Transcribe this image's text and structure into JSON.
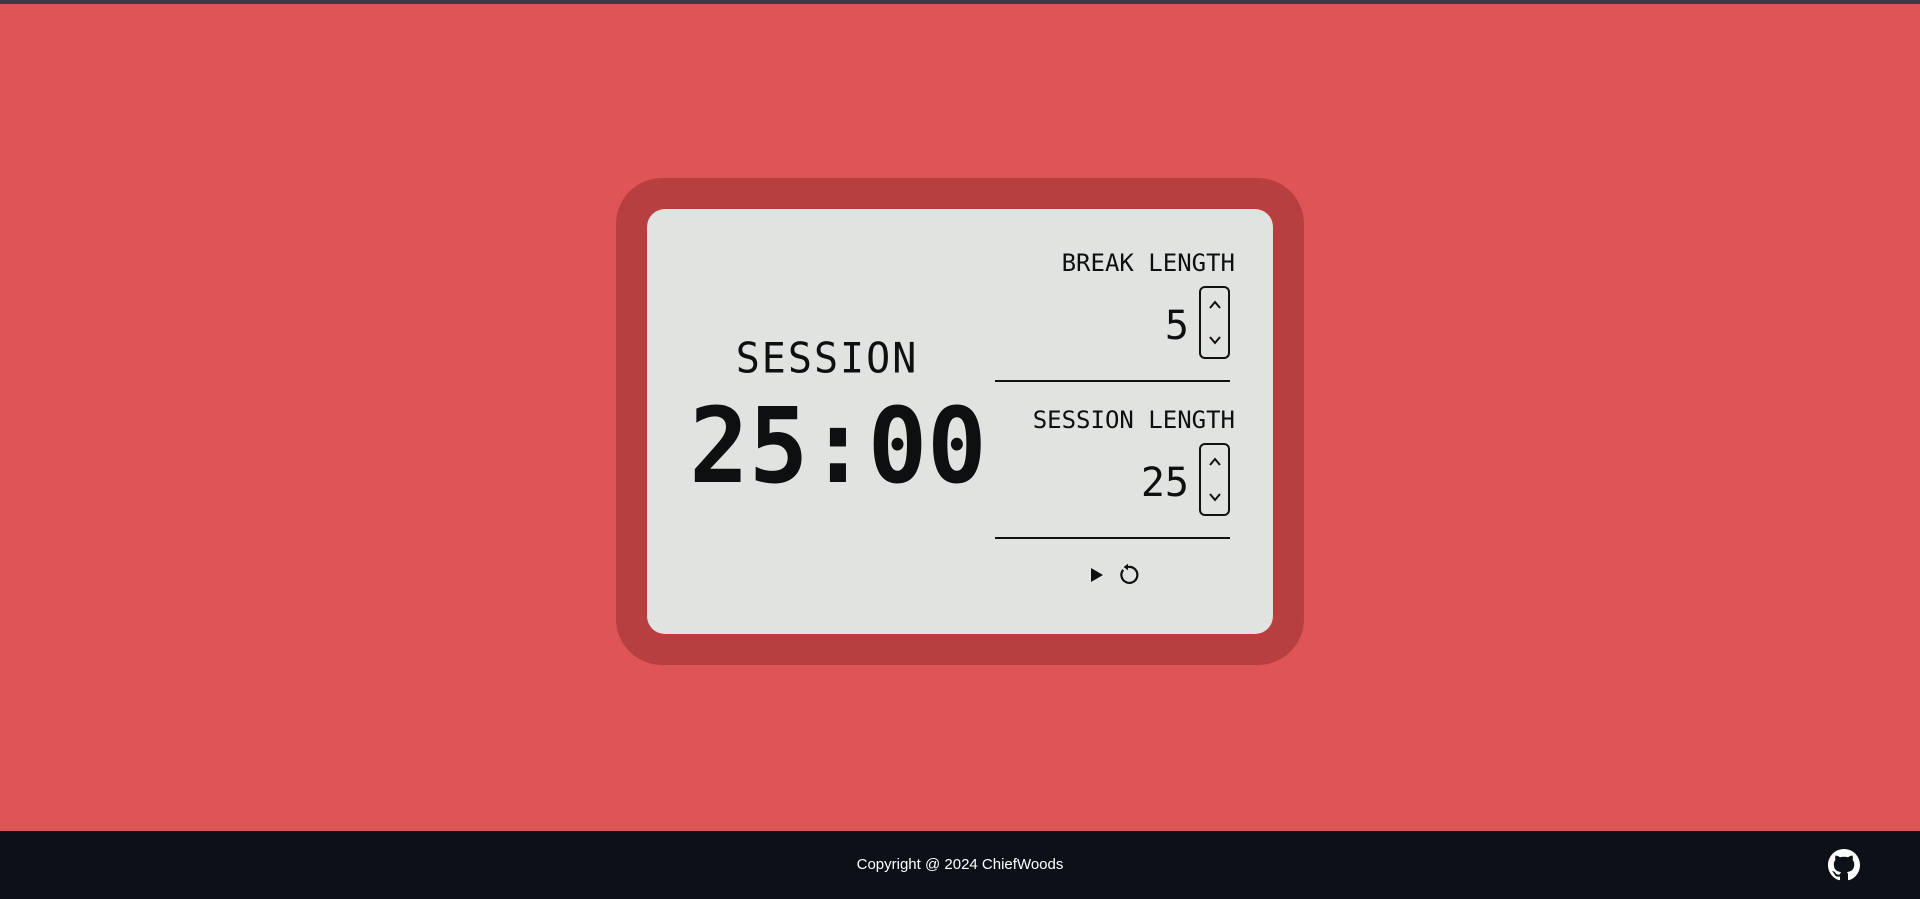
{
  "timer": {
    "label": "SESSION",
    "time": "25:00"
  },
  "break_setting": {
    "label": "BREAK LENGTH",
    "value": "5"
  },
  "session_setting": {
    "label": "SESSION LENGTH",
    "value": "25"
  },
  "icons": {
    "increment": "chevron-up-icon",
    "decrement": "chevron-down-icon",
    "start": "play-icon",
    "reset": "reset-icon",
    "github": "github-icon"
  },
  "footer": {
    "copyright": "Copyright @ 2024 ChiefWoods"
  },
  "colors": {
    "background": "#df5556",
    "device_frame": "#b83f40",
    "screen": "#e1e3e0",
    "footer": "#0c1118"
  }
}
